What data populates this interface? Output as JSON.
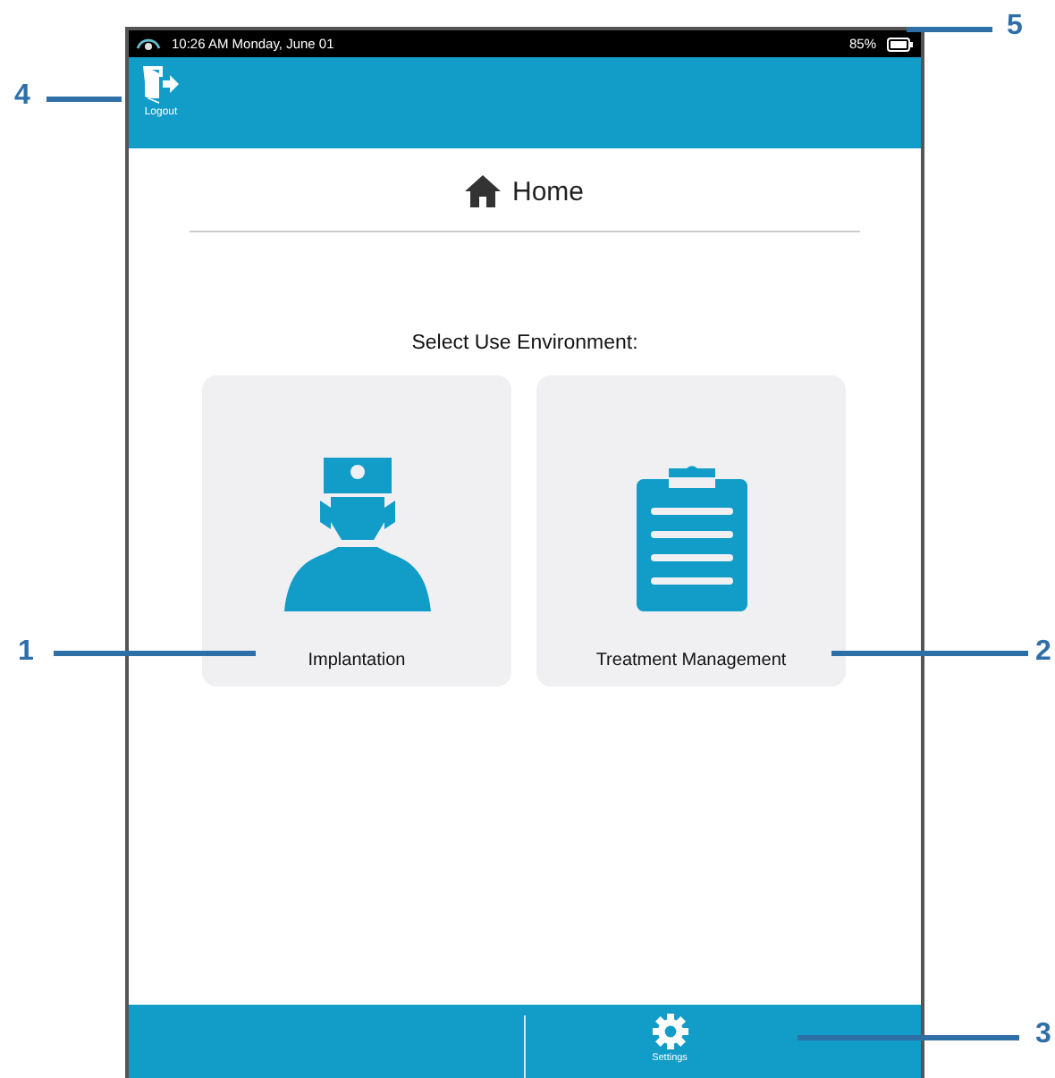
{
  "status_bar": {
    "time": "10:26 AM Monday, June 01",
    "battery": "85%"
  },
  "header": {
    "logout": "Logout"
  },
  "title": "Home",
  "prompt": "Select Use Environment:",
  "cards": [
    {
      "label": "Implantation",
      "kind": "surgeon"
    },
    {
      "label": "Treatment Management",
      "kind": "clipboard"
    }
  ],
  "bottom_bar": {
    "settings": "Settings"
  },
  "callouts": [
    {
      "label": "1"
    },
    {
      "label": "2"
    },
    {
      "label": "3"
    },
    {
      "label": "4"
    },
    {
      "label": "5"
    }
  ]
}
